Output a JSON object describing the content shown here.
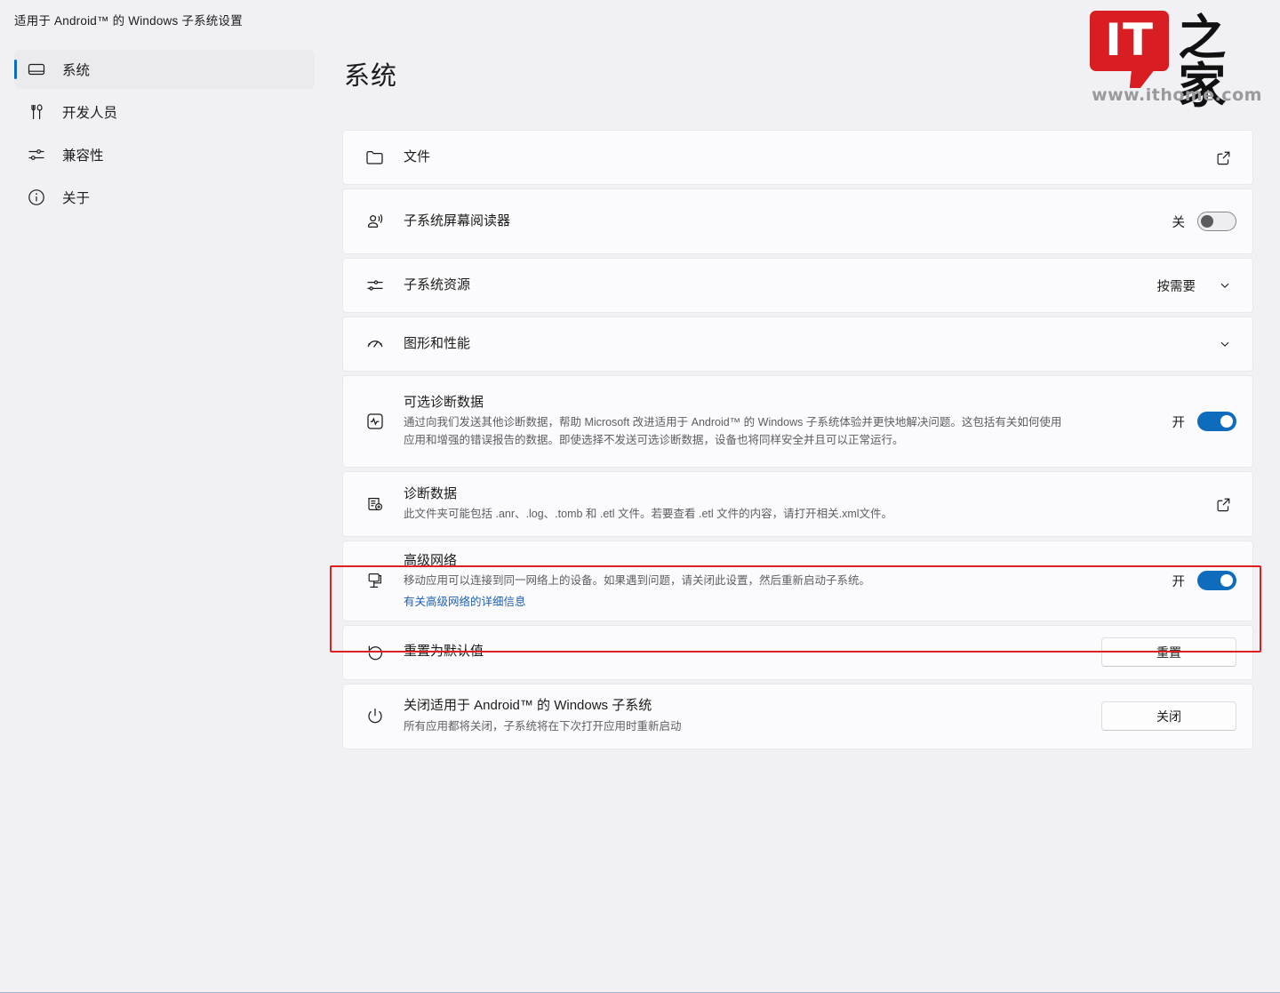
{
  "window": {
    "title": "适用于 Android™ 的 Windows 子系统设置"
  },
  "watermark": {
    "mark": "IT",
    "brand": "之家",
    "url": "www.ithome.com"
  },
  "sidebar": {
    "items": [
      {
        "label": "系统",
        "icon": "system-icon",
        "selected": true
      },
      {
        "label": "开发人员",
        "icon": "developer-icon",
        "selected": false
      },
      {
        "label": "兼容性",
        "icon": "compatibility-icon",
        "selected": false
      },
      {
        "label": "关于",
        "icon": "about-icon",
        "selected": false
      }
    ]
  },
  "page": {
    "title": "系统"
  },
  "settings": [
    {
      "key": "files",
      "icon": "folder-icon",
      "title": "文件",
      "desc": "",
      "control": "external-link"
    },
    {
      "key": "screen_reader",
      "icon": "narrator-icon",
      "title": "子系统屏幕阅读器",
      "desc": "",
      "control": "toggle",
      "state_label": "关",
      "state_on": false
    },
    {
      "key": "subsystem_resources",
      "icon": "sliders-icon",
      "title": "子系统资源",
      "desc": "",
      "control": "dropdown",
      "value": "按需要"
    },
    {
      "key": "graphics_performance",
      "icon": "speedometer-icon",
      "title": "图形和性能",
      "desc": "",
      "control": "expander"
    },
    {
      "key": "optional_diagnostic_data",
      "icon": "pulse-icon",
      "title": "可选诊断数据",
      "desc": "通过向我们发送其他诊断数据，帮助 Microsoft 改进适用于 Android™ 的 Windows 子系统体验并更快地解决问题。这包括有关如何使用应用和增强的错误报告的数据。即使选择不发送可选诊断数据，设备也将同样安全并且可以正常运行。",
      "control": "toggle",
      "state_label": "开",
      "state_on": true
    },
    {
      "key": "diagnostic_data",
      "icon": "diagnostic-file-icon",
      "title": "诊断数据",
      "desc": "此文件夹可能包括 .anr、.log、.tomb 和 .etl 文件。若要查看 .etl 文件的内容，请打开相关.xml文件。",
      "control": "external-link"
    },
    {
      "key": "advanced_networking",
      "icon": "network-icon",
      "title": "高级网络",
      "desc": "移动应用可以连接到同一网络上的设备。如果遇到问题，请关闭此设置，然后重新启动子系统。",
      "link": "有关高级网络的详细信息",
      "control": "toggle",
      "state_label": "开",
      "state_on": true,
      "highlighted": true
    },
    {
      "key": "reset_defaults",
      "icon": "undo-icon",
      "title": "重置为默认值",
      "desc": "",
      "control": "button",
      "button_label": "重置"
    },
    {
      "key": "shutdown_subsystem",
      "icon": "power-icon",
      "title": "关闭适用于 Android™ 的 Windows 子系统",
      "desc": "所有应用都将关闭，子系统将在下次打开应用时重新启动",
      "control": "button",
      "button_label": "关闭"
    }
  ],
  "colors": {
    "accent": "#0f6cbd",
    "link": "#1c5fb5",
    "highlight": "#e02020",
    "logo_red": "#d81e22",
    "page_bg": "#f1f1f5",
    "card_bg": "#fbfbfd"
  }
}
